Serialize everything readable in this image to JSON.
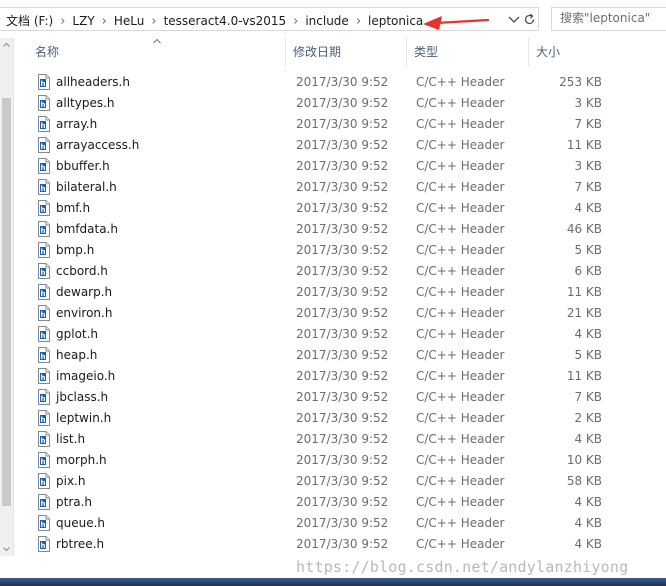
{
  "breadcrumb": {
    "items": [
      "文档 (F:)",
      "LZY",
      "HeLu",
      "tesseract4.0-vs2015",
      "include",
      "leptonica"
    ],
    "separator": "›"
  },
  "search": {
    "placeholder": "搜索\"leptonica\""
  },
  "icons": {
    "address_dropdown": "chevron-down-icon",
    "refresh": "refresh-icon",
    "file": "c-header-file-icon",
    "annotation": "red-arrow"
  },
  "colors": {
    "header_text": "#4c607a",
    "annotation_arrow": "#e8322f",
    "file_icon_accent": "#1f5ea8"
  },
  "columns": {
    "name": "名称",
    "date": "修改日期",
    "type": "类型",
    "size": "大小"
  },
  "files": [
    {
      "name": "allheaders.h",
      "date": "2017/3/30 9:52",
      "type": "C/C++ Header",
      "size": "253 KB"
    },
    {
      "name": "alltypes.h",
      "date": "2017/3/30 9:52",
      "type": "C/C++ Header",
      "size": "3 KB"
    },
    {
      "name": "array.h",
      "date": "2017/3/30 9:52",
      "type": "C/C++ Header",
      "size": "7 KB"
    },
    {
      "name": "arrayaccess.h",
      "date": "2017/3/30 9:52",
      "type": "C/C++ Header",
      "size": "11 KB"
    },
    {
      "name": "bbuffer.h",
      "date": "2017/3/30 9:52",
      "type": "C/C++ Header",
      "size": "3 KB"
    },
    {
      "name": "bilateral.h",
      "date": "2017/3/30 9:52",
      "type": "C/C++ Header",
      "size": "7 KB"
    },
    {
      "name": "bmf.h",
      "date": "2017/3/30 9:52",
      "type": "C/C++ Header",
      "size": "4 KB"
    },
    {
      "name": "bmfdata.h",
      "date": "2017/3/30 9:52",
      "type": "C/C++ Header",
      "size": "46 KB"
    },
    {
      "name": "bmp.h",
      "date": "2017/3/30 9:52",
      "type": "C/C++ Header",
      "size": "5 KB"
    },
    {
      "name": "ccbord.h",
      "date": "2017/3/30 9:52",
      "type": "C/C++ Header",
      "size": "6 KB"
    },
    {
      "name": "dewarp.h",
      "date": "2017/3/30 9:52",
      "type": "C/C++ Header",
      "size": "11 KB"
    },
    {
      "name": "environ.h",
      "date": "2017/3/30 9:52",
      "type": "C/C++ Header",
      "size": "21 KB"
    },
    {
      "name": "gplot.h",
      "date": "2017/3/30 9:52",
      "type": "C/C++ Header",
      "size": "4 KB"
    },
    {
      "name": "heap.h",
      "date": "2017/3/30 9:52",
      "type": "C/C++ Header",
      "size": "5 KB"
    },
    {
      "name": "imageio.h",
      "date": "2017/3/30 9:52",
      "type": "C/C++ Header",
      "size": "11 KB"
    },
    {
      "name": "jbclass.h",
      "date": "2017/3/30 9:52",
      "type": "C/C++ Header",
      "size": "7 KB"
    },
    {
      "name": "leptwin.h",
      "date": "2017/3/30 9:52",
      "type": "C/C++ Header",
      "size": "2 KB"
    },
    {
      "name": "list.h",
      "date": "2017/3/30 9:52",
      "type": "C/C++ Header",
      "size": "4 KB"
    },
    {
      "name": "morph.h",
      "date": "2017/3/30 9:52",
      "type": "C/C++ Header",
      "size": "10 KB"
    },
    {
      "name": "pix.h",
      "date": "2017/3/30 9:52",
      "type": "C/C++ Header",
      "size": "58 KB"
    },
    {
      "name": "ptra.h",
      "date": "2017/3/30 9:52",
      "type": "C/C++ Header",
      "size": "4 KB"
    },
    {
      "name": "queue.h",
      "date": "2017/3/30 9:52",
      "type": "C/C++ Header",
      "size": "4 KB"
    },
    {
      "name": "rbtree.h",
      "date": "2017/3/30 9:52",
      "type": "C/C++ Header",
      "size": "4 KB"
    }
  ],
  "watermark": "https://blog.csdn.net/andylanzhiyong"
}
